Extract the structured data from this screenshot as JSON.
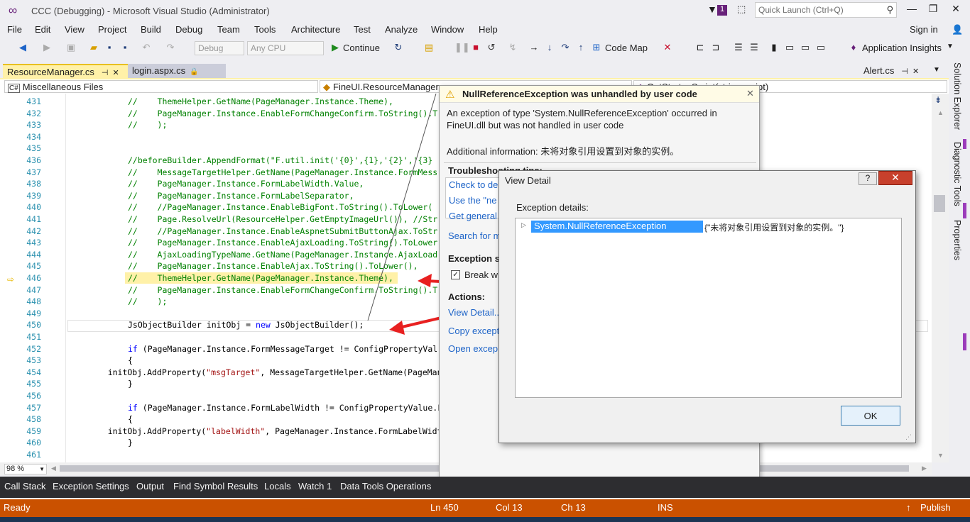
{
  "window": {
    "title": "CCC (Debugging) - Microsoft Visual Studio (Administrator)",
    "notification_count": "1",
    "quick_launch_placeholder": "Quick Launch (Ctrl+Q)",
    "sign_in": "Sign in"
  },
  "menu": [
    "File",
    "Edit",
    "View",
    "Project",
    "Build",
    "Debug",
    "Team",
    "Tools",
    "Architecture",
    "Test",
    "Analyze",
    "Window",
    "Help"
  ],
  "toolbar": {
    "config": "Debug",
    "platform": "Any CPU",
    "continue": "Continue",
    "code_map": "Code Map",
    "app_insights": "Application Insights"
  },
  "tabs": {
    "active": "ResourceManager.cs",
    "second": "login.aspx.cs",
    "right": "Alert.cs"
  },
  "navbar": {
    "project": "Miscellaneous Files",
    "class": "FineUI.ResourceManager",
    "member": "GetStartupScript(string script)"
  },
  "code_lines": [
    {
      "n": "431",
      "t": "//    ThemeHelper.GetName(PageManager.Instance.Theme),"
    },
    {
      "n": "432",
      "t": "//    PageManager.Instance.EnableFormChangeConfirm.ToString().T"
    },
    {
      "n": "433",
      "t": "//    );"
    },
    {
      "n": "434",
      "t": ""
    },
    {
      "n": "435",
      "t": ""
    },
    {
      "n": "436",
      "t": "//beforeBuilder.AppendFormat(\"F.util.init('{0}',{1},'{2}','{3}"
    },
    {
      "n": "437",
      "t": "//    MessageTargetHelper.GetName(PageManager.Instance.FormMess"
    },
    {
      "n": "438",
      "t": "//    PageManager.Instance.FormLabelWidth.Value,"
    },
    {
      "n": "439",
      "t": "//    PageManager.Instance.FormLabelSeparator,"
    },
    {
      "n": "440",
      "t": "//    //PageManager.Instance.EnableBigFont.ToString().ToLower("
    },
    {
      "n": "441",
      "t": "//    Page.ResolveUrl(ResourceHelper.GetEmptyImageUrl()), //Str"
    },
    {
      "n": "442",
      "t": "//    //PageManager.Instance.EnableAspnetSubmitButtonAjax.ToStr"
    },
    {
      "n": "443",
      "t": "//    PageManager.Instance.EnableAjaxLoading.ToString().ToLower"
    },
    {
      "n": "444",
      "t": "//    AjaxLoadingTypeName.GetName(PageManager.Instance.AjaxLoad"
    },
    {
      "n": "445",
      "t": "//    PageManager.Instance.EnableAjax.ToString().ToLower(),"
    },
    {
      "n": "446",
      "t": "//    ThemeHelper.GetName(PageManager.Instance.Theme),"
    },
    {
      "n": "447",
      "t": "//    PageManager.Instance.EnableFormChangeConfirm.ToString().T"
    },
    {
      "n": "448",
      "t": "//    );"
    },
    {
      "n": "449",
      "t": ""
    },
    {
      "n": "450",
      "t": "JsObjectBuilder initObj = new JsObjectBuilder();"
    },
    {
      "n": "451",
      "t": ""
    },
    {
      "n": "452",
      "t": "if (PageManager.Instance.FormMessageTarget != ConfigPropertyVal"
    },
    {
      "n": "453",
      "t": "{"
    },
    {
      "n": "454",
      "t": "    initObj.AddProperty(\"msgTarget\", MessageTargetHelper.GetName(PageManage"
    },
    {
      "n": "455",
      "t": "}"
    },
    {
      "n": "456",
      "t": ""
    },
    {
      "n": "457",
      "t": "if (PageManager.Instance.FormLabelWidth != ConfigPropertyValue.FORM_LABELWI"
    },
    {
      "n": "458",
      "t": "{"
    },
    {
      "n": "459",
      "t": "    initObj.AddProperty(\"labelWidth\", PageManager.Instance.FormLabelWidth.V"
    },
    {
      "n": "460",
      "t": "}"
    },
    {
      "n": "461",
      "t": ""
    }
  ],
  "zoom": "98 %",
  "right_tabs": [
    "Solution Explorer",
    "Diagnostic Tools",
    "Properties"
  ],
  "exception_helper": {
    "title": "NullReferenceException was unhandled by user code",
    "message": "An exception of type 'System.NullReferenceException' occurred in FineUI.dll but was not handled in user code",
    "additional": "Additional information: 未将对象引用设置到对象的实例。",
    "tips_heading": "Troubleshooting tips:",
    "tips": [
      "Check to de",
      "Use the \"ne",
      "Get general"
    ],
    "search": "Search for m",
    "settings_heading": "Exception s",
    "break_when": "Break w",
    "actions_heading": "Actions:",
    "actions": [
      "View Detail...",
      "Copy except",
      "Open excep"
    ]
  },
  "view_detail": {
    "title": "View Detail",
    "label": "Exception details:",
    "exception_name": "System.NullReferenceException",
    "exception_value": "{\"未将对象引用设置到对象的实例。\"}",
    "ok": "OK",
    "help": "?",
    "close": "✕"
  },
  "bottom_tabs": [
    "Call Stack",
    "Exception Settings",
    "Output",
    "Find Symbol Results",
    "Locals",
    "Watch 1",
    "Data Tools Operations"
  ],
  "status": {
    "ready": "Ready",
    "ln": "Ln 450",
    "col": "Col 13",
    "ch": "Ch 13",
    "ins": "INS",
    "publish": "Publish"
  },
  "colors": {
    "status_bar": "#ca5100",
    "accent": "#68217a",
    "highlight": "#fff1a8"
  }
}
